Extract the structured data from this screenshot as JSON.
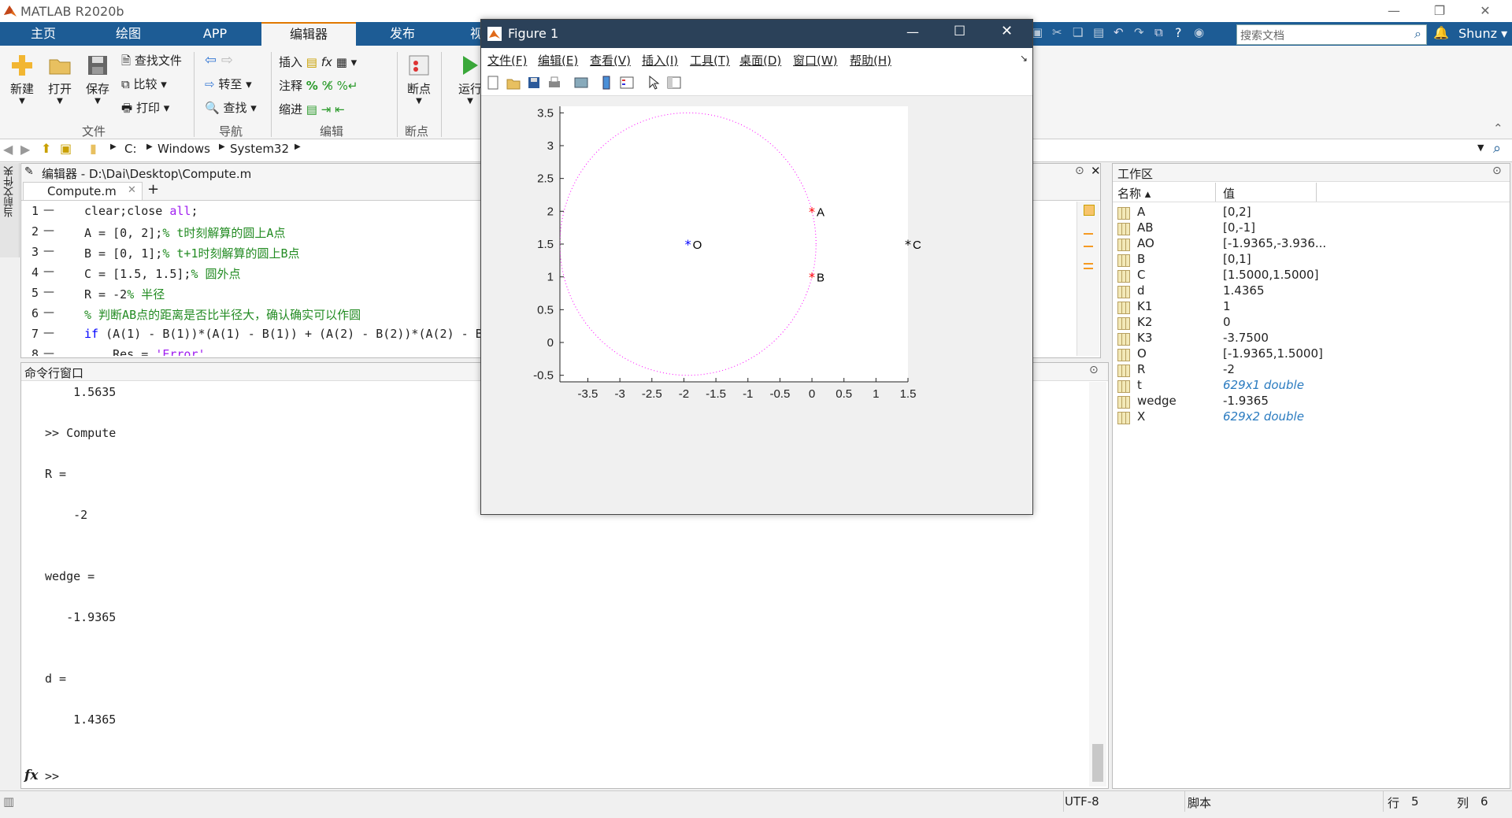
{
  "app": {
    "title": "MATLAB R2020b"
  },
  "tabs": [
    "主页",
    "绘图",
    "APP",
    "编辑器",
    "发布",
    "视"
  ],
  "active_tab": "编辑器",
  "ribbon": {
    "file": {
      "new": "新建",
      "open": "打开",
      "save": "保存",
      "find_files": "查找文件",
      "compare": "比较",
      "print": "打印",
      "group": "文件"
    },
    "nav": {
      "goto": "转至",
      "find": "查找",
      "group": "导航"
    },
    "edit": {
      "insert": "插入",
      "comment": "注释",
      "indent": "缩进",
      "group": "编辑"
    },
    "breakpoints": {
      "label": "断点",
      "group": "断点"
    },
    "run": {
      "label": "运行"
    }
  },
  "search": {
    "placeholder": "搜索文档"
  },
  "user": "Shunz",
  "address": {
    "parts": [
      "C:",
      "Windows",
      "System32"
    ]
  },
  "current_folder_label": "当前文件夹",
  "editor": {
    "title": "编辑器 - D:\\Dai\\Desktop\\Compute.m",
    "tab": "Compute.m",
    "lines": [
      {
        "n": "1",
        "parts": [
          {
            "t": "clear;close ",
            "c": ""
          },
          {
            "t": "all",
            "c": "str"
          },
          {
            "t": ";",
            "c": ""
          }
        ]
      },
      {
        "n": "2",
        "parts": [
          {
            "t": "A = [0, 2];",
            "c": ""
          },
          {
            "t": "% t时刻解算的圆上A点",
            "c": "cm"
          }
        ]
      },
      {
        "n": "3",
        "parts": [
          {
            "t": "B = [0, 1];",
            "c": ""
          },
          {
            "t": "% t+1时刻解算的圆上B点",
            "c": "cm"
          }
        ]
      },
      {
        "n": "4",
        "parts": [
          {
            "t": "C = [1.5, 1.5];",
            "c": ""
          },
          {
            "t": "% 圆外点",
            "c": "cm"
          }
        ]
      },
      {
        "n": "5",
        "parts": [
          {
            "t": "R = -2",
            "c": ""
          },
          {
            "t": "% 半径",
            "c": "cm"
          }
        ]
      },
      {
        "n": "6",
        "parts": [
          {
            "t": "% 判断AB点的距离是否比半径大，确认确实可以作圆",
            "c": "cm"
          }
        ]
      },
      {
        "n": "7",
        "parts": [
          {
            "t": "if",
            "c": "kw"
          },
          {
            "t": " (A(1) - B(1))*(A(1) - B(1)) + (A(2) - B(2))*(A(2) - B",
            "c": ""
          }
        ]
      },
      {
        "n": "8",
        "parts": [
          {
            "t": "    Res = ",
            "c": ""
          },
          {
            "t": "'Error'",
            "c": "str"
          }
        ]
      }
    ]
  },
  "cmd": {
    "title": "命令行窗口",
    "lines": [
      "    1.5635",
      "",
      ">> Compute",
      "",
      "R =",
      "",
      "    -2",
      "",
      "",
      "wedge =",
      "",
      "   -1.9365",
      "",
      "",
      "d =",
      "",
      "    1.4365",
      ""
    ],
    "prompt": ">>"
  },
  "workspace": {
    "title": "工作区",
    "col_name": "名称 ▴",
    "col_value": "值",
    "rows": [
      {
        "name": "A",
        "value": "[0,2]",
        "italic": false
      },
      {
        "name": "AB",
        "value": "[0,-1]",
        "italic": false
      },
      {
        "name": "AO",
        "value": "[-1.9365,-3.936...",
        "italic": false
      },
      {
        "name": "B",
        "value": "[0,1]",
        "italic": false
      },
      {
        "name": "C",
        "value": "[1.5000,1.5000]",
        "italic": false
      },
      {
        "name": "d",
        "value": "1.4365",
        "italic": false
      },
      {
        "name": "K1",
        "value": "1",
        "italic": false
      },
      {
        "name": "K2",
        "value": "0",
        "italic": false
      },
      {
        "name": "K3",
        "value": "-3.7500",
        "italic": false
      },
      {
        "name": "O",
        "value": "[-1.9365,1.5000]",
        "italic": false
      },
      {
        "name": "R",
        "value": "-2",
        "italic": false
      },
      {
        "name": "t",
        "value": "629x1 double",
        "italic": true
      },
      {
        "name": "wedge",
        "value": "-1.9365",
        "italic": false
      },
      {
        "name": "X",
        "value": "629x2 double",
        "italic": true
      }
    ]
  },
  "status": {
    "encoding": "UTF-8",
    "type": "脚本",
    "row_label": "行",
    "row": "5",
    "col_label": "列",
    "col": "6"
  },
  "figure": {
    "title": "Figure 1",
    "menu": [
      "文件(F)",
      "编辑(E)",
      "查看(V)",
      "插入(I)",
      "工具(T)",
      "桌面(D)",
      "窗口(W)",
      "帮助(H)"
    ]
  },
  "chart_data": {
    "type": "scatter",
    "xlim": [
      -3.9365,
      1.5
    ],
    "ylim": [
      -0.6,
      3.6
    ],
    "xticks": [
      -3.5,
      -3,
      -2.5,
      -2,
      -1.5,
      -1,
      -0.5,
      0,
      0.5,
      1,
      1.5
    ],
    "yticks": [
      -0.5,
      0,
      0.5,
      1,
      1.5,
      2,
      2.5,
      3,
      3.5
    ],
    "circle": {
      "center": [
        -1.9365,
        1.5
      ],
      "radius": 2,
      "color": "#ff00ff",
      "style": "dotted"
    },
    "points": [
      {
        "label": "O",
        "x": -1.9365,
        "y": 1.5,
        "color": "#0000ff"
      },
      {
        "label": "A",
        "x": 0,
        "y": 2,
        "color": "#ff0000"
      },
      {
        "label": "B",
        "x": 0,
        "y": 1,
        "color": "#ff0000"
      },
      {
        "label": "C",
        "x": 1.5,
        "y": 1.5,
        "color": "#000000"
      }
    ],
    "grid": false
  },
  "colors": {
    "tab_bar": "#1d5c95",
    "figure_title": "#2b4159",
    "active_tab_accent": "#e07800"
  }
}
